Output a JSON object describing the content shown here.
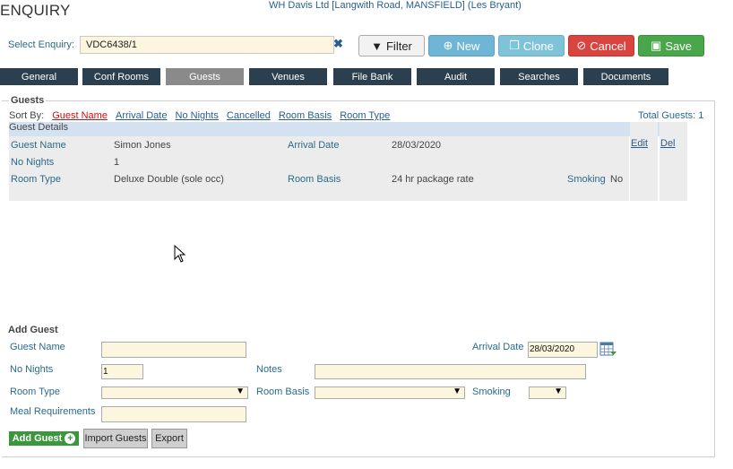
{
  "header": {
    "title": "ENQUIRY",
    "client": "WH Davis Ltd [Langwith Road, MANSFIELD] (Les Bryant)"
  },
  "select_enquiry": {
    "label": "Select Enquiry:",
    "value": "VDC6438/1"
  },
  "toolbar": {
    "filter": "Filter",
    "new": "New",
    "clone": "Clone",
    "cancel": "Cancel",
    "save": "Save"
  },
  "tabs": [
    "General",
    "Conf Rooms",
    "Guests",
    "Venues",
    "File Bank",
    "Audit",
    "Searches",
    "Documents"
  ],
  "active_tab": "Guests",
  "guests": {
    "legend": "Guests",
    "sort_label": "Sort By:",
    "sort_options": [
      "Guest Name",
      "Arrival Date",
      "No Nights",
      "Cancelled",
      "Room Basis",
      "Room Type"
    ],
    "total": "Total Guests: 1",
    "details_header": "Guest Details",
    "record": {
      "guest_name_label": "Guest Name",
      "guest_name": "Simon Jones",
      "arrival_label": "Arrival Date",
      "arrival": "28/03/2020",
      "nights_label": "No Nights",
      "nights": "1",
      "room_type_label": "Room Type",
      "room_type": "Deluxe Double (sole occ)",
      "room_basis_label": "Room Basis",
      "room_basis": "24 hr package rate",
      "smoking_label": "Smoking",
      "smoking": "No",
      "edit": "Edit",
      "del": "Del"
    }
  },
  "add_guest": {
    "title": "Add Guest",
    "guest_name_label": "Guest Name",
    "arrival_label": "Arrival Date",
    "arrival_value": "28/03/2020",
    "nights_label": "No Nights",
    "nights_value": "1",
    "notes_label": "Notes",
    "room_type_label": "Room Type",
    "room_basis_label": "Room Basis",
    "smoking_label": "Smoking",
    "meal_label": "Meal Requirements",
    "add_button": "Add Guest",
    "import_button": "Import Guests",
    "export_button": "Export"
  }
}
